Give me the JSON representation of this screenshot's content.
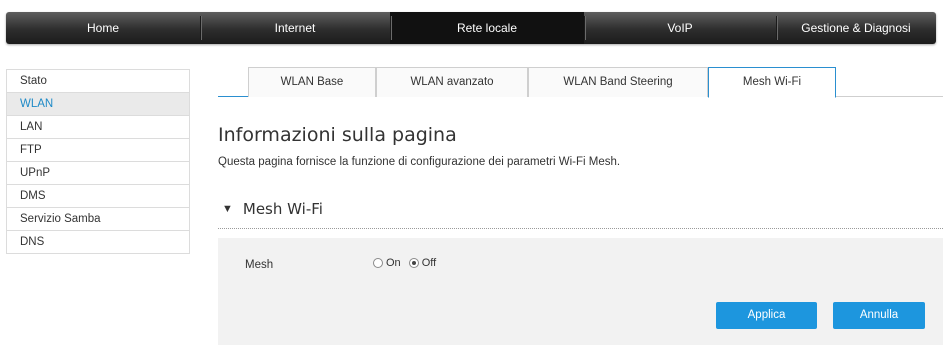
{
  "topnav": {
    "items": [
      {
        "label": "Home"
      },
      {
        "label": "Internet"
      },
      {
        "label": "Rete locale"
      },
      {
        "label": "VoIP"
      },
      {
        "label": "Gestione & Diagnosi"
      }
    ],
    "active": "Rete locale"
  },
  "sidebar": {
    "items": [
      {
        "label": "Stato"
      },
      {
        "label": "WLAN"
      },
      {
        "label": "LAN"
      },
      {
        "label": "FTP"
      },
      {
        "label": "UPnP"
      },
      {
        "label": "DMS"
      },
      {
        "label": "Servizio Samba"
      },
      {
        "label": "DNS"
      }
    ],
    "active": "WLAN"
  },
  "tabs": {
    "items": [
      {
        "label": "WLAN Base"
      },
      {
        "label": "WLAN avanzato"
      },
      {
        "label": "WLAN Band Steering"
      },
      {
        "label": "Mesh Wi-Fi"
      }
    ],
    "active": "Mesh Wi-Fi"
  },
  "page": {
    "title": "Informazioni sulla pagina",
    "description": "Questa pagina fornisce la funzione di configurazione dei parametri Wi-Fi Mesh."
  },
  "section": {
    "toggle_icon": "triangle-down-icon",
    "title": "Mesh Wi-Fi"
  },
  "mesh": {
    "label": "Mesh",
    "options": [
      {
        "label": "On",
        "checked": false
      },
      {
        "label": "Off",
        "checked": true
      }
    ]
  },
  "buttons": {
    "apply": "Applica",
    "cancel": "Annulla"
  },
  "colors": {
    "accent": "#1d96de",
    "active_side_text": "#1e8ac7",
    "nav_bg": "#2d2d2d"
  }
}
